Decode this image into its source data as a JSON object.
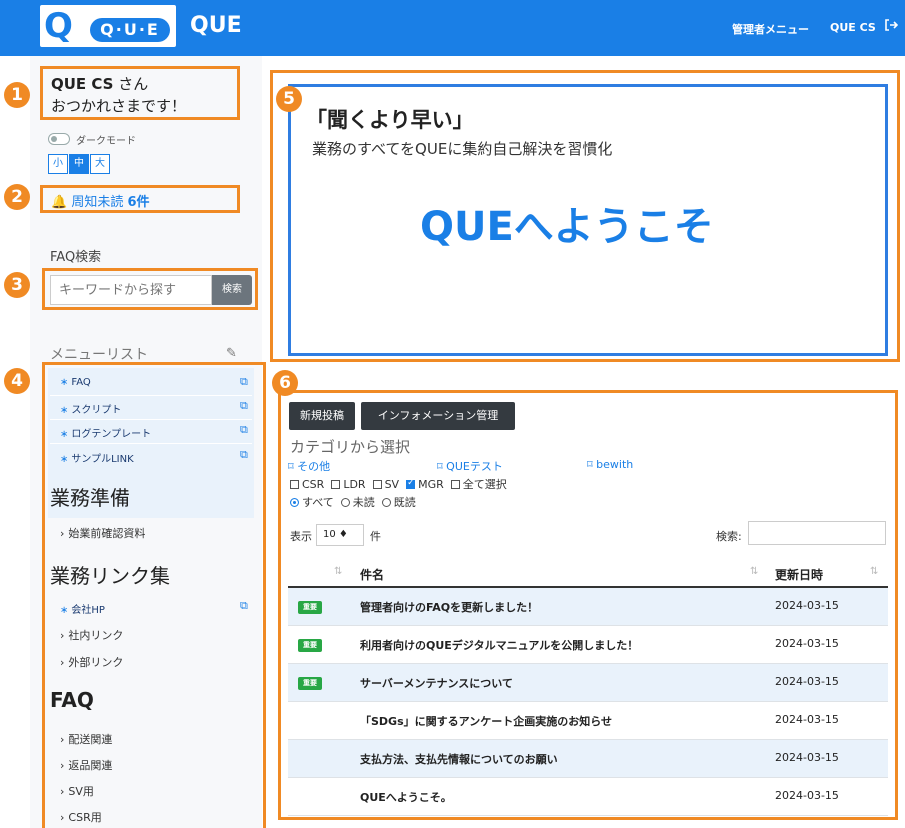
{
  "header": {
    "logo_letter": "Q",
    "logo_text": "Q·U·E",
    "app_title": "QUE",
    "admin_menu": "管理者メニュー",
    "user": "QUE CS",
    "logout_icon": "logout-icon"
  },
  "sidebar": {
    "user_name": "QUE CS",
    "user_suffix": " さん",
    "greeting": "おつかれさまです！",
    "dark_mode_label": "ダークモード",
    "font_sizes": [
      "小",
      "中",
      "大"
    ],
    "font_size_selected": "中",
    "notice_prefix": "周知未読",
    "notice_count": "6件",
    "faq_search_label": "FAQ検索",
    "search_placeholder": "キーワードから探す",
    "search_button": "検索",
    "menu_list_label": "メニューリスト",
    "menu_items": [
      "FAQ",
      "スクリプト",
      "ログテンプレート",
      "サンプルLINK"
    ],
    "section_prep": "業務準備",
    "prep_items": [
      "始業前確認資料"
    ],
    "section_links": "業務リンク集",
    "link_items": [
      "会社HP",
      "社内リンク",
      "外部リンク"
    ],
    "section_faq": "FAQ",
    "faq_items": [
      "配送関連",
      "返品関連",
      "SV用",
      "CSR用"
    ]
  },
  "badges": [
    "1",
    "2",
    "3",
    "4",
    "5",
    "6"
  ],
  "hero": {
    "title": "「聞くより早い」",
    "subtitle": "業務のすべてをQUEに集約自己解決を習慣化",
    "welcome": "QUEへようこそ"
  },
  "info": {
    "new_post": "新規投稿",
    "info_manage": "インフォメーション管理",
    "category_label": "カテゴリから選択",
    "categories": [
      "その他",
      "QUEテスト",
      "bewith"
    ],
    "checkboxes": [
      {
        "label": "CSR",
        "checked": false
      },
      {
        "label": "LDR",
        "checked": false
      },
      {
        "label": "SV",
        "checked": false
      },
      {
        "label": "MGR",
        "checked": true
      },
      {
        "label": "全て選択",
        "checked": false
      }
    ],
    "radios": [
      {
        "label": "すべて",
        "checked": true
      },
      {
        "label": "未読",
        "checked": false
      },
      {
        "label": "既読",
        "checked": false
      }
    ],
    "show_label": "表示",
    "page_length": "10 ♦",
    "unit_label": "件",
    "search_label": "検索:",
    "col_subject": "件名",
    "col_updated": "更新日時",
    "sort_icon": "⇅",
    "tag_important": "重要",
    "rows": [
      {
        "important": true,
        "subject": "管理者向けのFAQを更新しました！",
        "date": "2024-03-15"
      },
      {
        "important": true,
        "subject": "利用者向けのQUEデジタルマニュアルを公開しました！",
        "date": "2024-03-15"
      },
      {
        "important": true,
        "subject": "サーバーメンテナンスについて",
        "date": "2024-03-15"
      },
      {
        "important": false,
        "subject": "「SDGs」に関するアンケート企画実施のお知らせ",
        "date": "2024-03-15"
      },
      {
        "important": false,
        "subject": "支払方法、支払先情報についてのお願い",
        "date": "2024-03-15"
      },
      {
        "important": false,
        "subject": "QUEへようこそ。",
        "date": "2024-03-15"
      }
    ]
  },
  "colors": {
    "brand_blue": "#1a7fe6",
    "highlight_orange": "#f08a24",
    "tag_green": "#28a745"
  }
}
